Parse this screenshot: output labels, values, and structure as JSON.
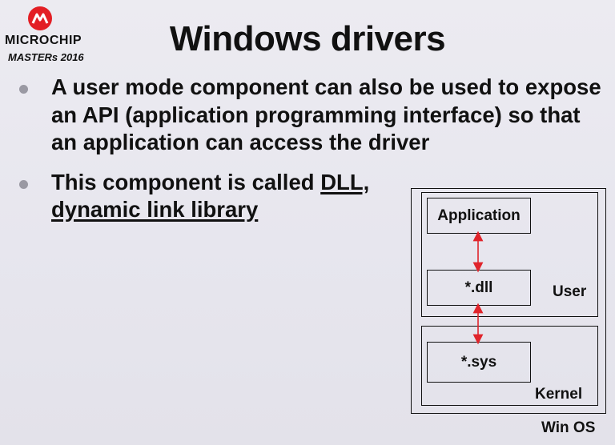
{
  "logo": {
    "brand": "MICROCHIP",
    "event": "MASTERs 2016"
  },
  "slide": {
    "title": "Windows drivers",
    "bullets": [
      {
        "text": "A user mode component can also be used to expose an API (application programming interface) so that an application can access the driver"
      },
      {
        "lead": "This component is called",
        "emphasis": "DLL, dynamic link library"
      }
    ]
  },
  "diagram": {
    "os_label": "Win OS",
    "user_label": "User",
    "kernel_label": "Kernel",
    "application": "Application",
    "dll": "*.dll",
    "sys": "*.sys",
    "arrow_color": "#e0242b"
  },
  "colors": {
    "logo_red": "#e31e24",
    "bullet_dot": "#9a99a3"
  }
}
